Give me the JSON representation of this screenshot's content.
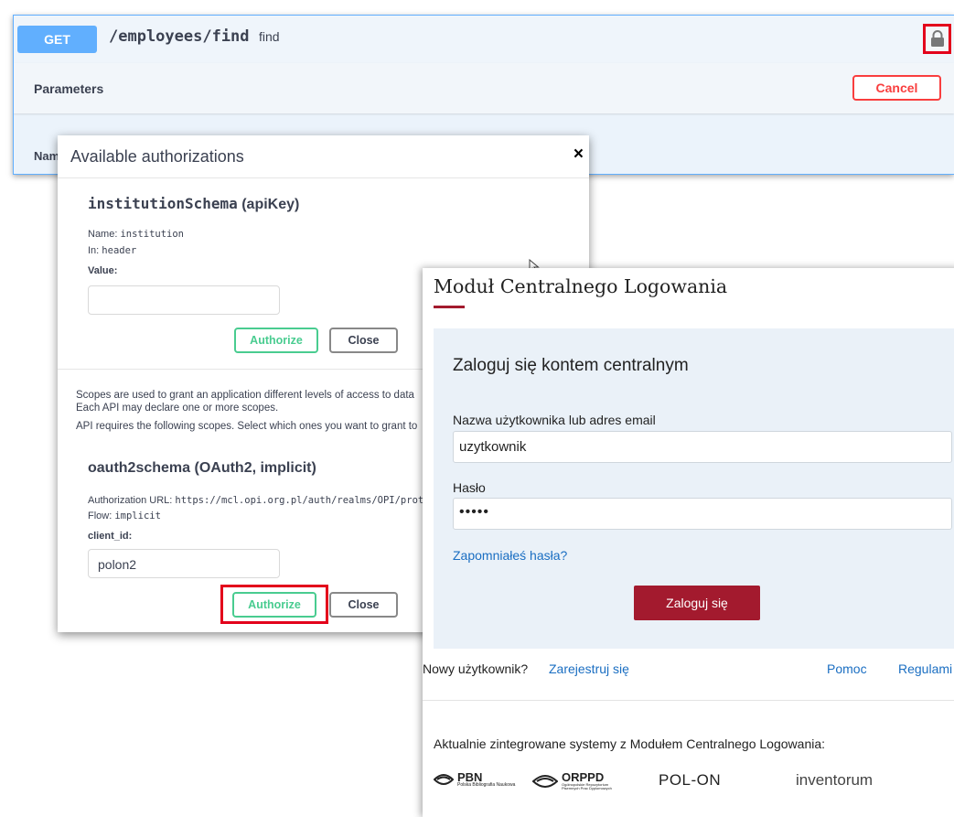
{
  "swagger": {
    "method": "GET",
    "path": "/employees/find",
    "summary": "find",
    "parameters_title": "Parameters",
    "cancel_label": "Cancel",
    "name_column_partial": "Nam",
    "lock_icon": "lock-icon"
  },
  "auth_modal": {
    "title": "Available authorizations",
    "close_symbol": "×",
    "api_key_scheme": {
      "title": "institutionSchema (apiKey)",
      "title_name": "institutionSchema",
      "title_type": "(apiKey)",
      "name_label": "Name:",
      "name_value": "institution",
      "in_label": "In:",
      "in_value": "header",
      "value_label": "Value:",
      "value": "",
      "authorize_label": "Authorize",
      "close_label": "Close"
    },
    "scopes_text_line1": "Scopes are used to grant an application different levels of access to data",
    "scopes_text_line2": "Each API may declare one or more scopes.",
    "scopes_text_line3": "API requires the following scopes. Select which ones you want to grant to",
    "oauth_scheme": {
      "title": "oauth2schema (OAuth2, implicit)",
      "auth_url_label": "Authorization URL:",
      "auth_url": "https://mcl.opi.org.pl/auth/realms/OPI/proto",
      "flow_label": "Flow:",
      "flow_value": "implicit",
      "client_id_label": "client_id:",
      "client_id_value": "polon2",
      "authorize_label": "Authorize",
      "close_label": "Close"
    }
  },
  "mcl": {
    "title": "Moduł Centralnego Logowania",
    "heading": "Zaloguj się kontem centralnym",
    "username_label": "Nazwa użytkownika lub adres email",
    "username_value": "uzytkownik",
    "password_label": "Hasło",
    "password_value": "•••••",
    "forgot_label": "Zapomniałeś hasła?",
    "login_label": "Zaloguj się",
    "new_user_label": "Nowy użytkownik?",
    "register_label": "Zarejestruj się",
    "help_label": "Pomoc",
    "rules_label": "Regulami",
    "integrated_label": "Aktualnie zintegrowane systemy z Modułem Centralnego Logowania:",
    "logos": {
      "pbn": "PBN",
      "pbn_sub": "Polska Bibliografia Naukowa",
      "orppd": "ORPPD",
      "orppd_sub": "Ogólnopolskie Repozytorium Pisemnych Prac Dyplomowych",
      "polon": "POL-ON",
      "inventorum": "inventorum"
    }
  },
  "colors": {
    "get_blue": "#61affe",
    "authorize_green": "#49cc90",
    "cancel_red": "#f93e3e",
    "highlight_red": "#e3001b",
    "mcl_maroon": "#a31a2e",
    "link_blue": "#1a6ec2"
  }
}
